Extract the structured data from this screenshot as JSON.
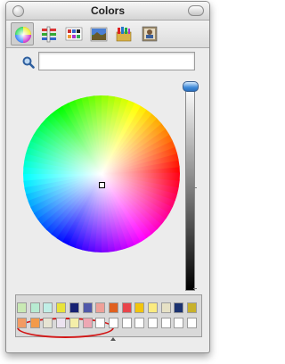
{
  "window": {
    "title": "Colors"
  },
  "toolbar": {
    "modes": [
      {
        "name": "color-wheel-mode-icon",
        "selected": true
      },
      {
        "name": "color-sliders-mode-icon",
        "selected": false
      },
      {
        "name": "color-palettes-mode-icon",
        "selected": false
      },
      {
        "name": "image-palettes-mode-icon",
        "selected": false
      },
      {
        "name": "crayons-mode-icon",
        "selected": false
      },
      {
        "name": "custom-picker-mode-icon",
        "selected": false
      }
    ]
  },
  "search": {
    "value": "",
    "placeholder": ""
  },
  "brightness": {
    "level": 1.0
  },
  "swatches": {
    "row1": [
      "#c9e9b4",
      "#b7ebd1",
      "#c0eee6",
      "#e8e33a",
      "#172273",
      "#5058aa",
      "#efa098",
      "#e0601f",
      "#e8454b",
      "#f2c50d",
      "#fbeb80",
      "#e6e1c5",
      "#1b3270",
      "#c8b12b"
    ],
    "row2": [
      "#f29b63",
      "#f39a4a",
      "#e7e4d3",
      "#ece3f0",
      "#f4eea9",
      "#eda7b3",
      "#ffffff",
      "#ffffff",
      "#ffffff",
      "#ffffff",
      "#ffffff",
      "#ffffff",
      "#ffffff",
      "#ffffff"
    ]
  },
  "colors": {
    "annotation": "#d21515",
    "slider_knob": "#3f8ad8"
  }
}
